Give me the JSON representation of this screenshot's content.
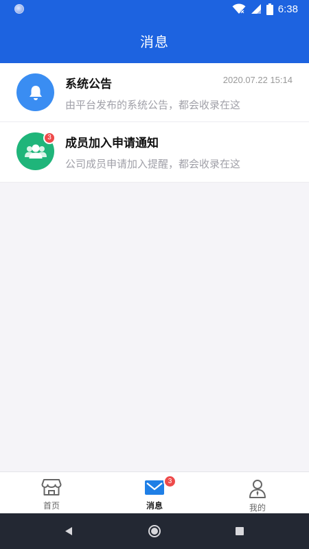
{
  "status_bar": {
    "time": "6:38"
  },
  "header": {
    "title": "消息"
  },
  "messages": [
    {
      "title": "系统公告",
      "time": "2020.07.22 15:14",
      "description": "由平台发布的系统公告，都会收录在这",
      "icon": "bell-icon",
      "color": "#3a8df2"
    },
    {
      "title": "成员加入申请通知",
      "badge": "3",
      "description": "公司成员申请加入提醒，都会收录在这",
      "icon": "members-icon",
      "color": "#1fb57a"
    }
  ],
  "tabs": [
    {
      "label": "首页",
      "icon": "store-icon"
    },
    {
      "label": "消息",
      "icon": "mail-icon",
      "badge": "3",
      "active": true
    },
    {
      "label": "我的",
      "icon": "person-icon"
    }
  ],
  "theme": {
    "primary": "#1d63e0",
    "badge": "#ee4a4a"
  }
}
